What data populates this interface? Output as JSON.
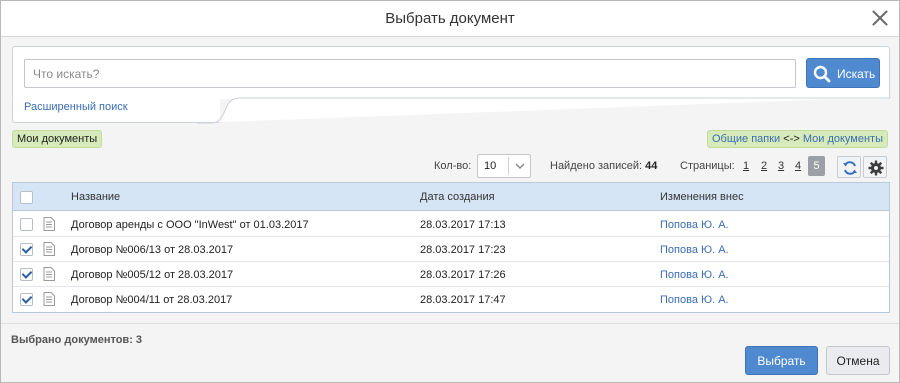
{
  "dialog": {
    "title": "Выбрать документ"
  },
  "search": {
    "placeholder": "Что искать?",
    "value": "",
    "button_label": "Искать",
    "advanced_link": "Расширенный поиск"
  },
  "filters": {
    "my_documents": "Мои документы",
    "shared_folders": "Общие папки",
    "arrow": "<->",
    "my_documents_link": "Мои документы"
  },
  "pager": {
    "count_label": "Кол-во:",
    "count_value": "10",
    "found_label": "Найдено записей:",
    "found_value": "44",
    "pages_label": "Страницы:",
    "pages": [
      "1",
      "2",
      "3",
      "4"
    ],
    "active_page": "5"
  },
  "table": {
    "columns": [
      "Название",
      "Дата создания",
      "Изменения внес"
    ],
    "rows": [
      {
        "checked": false,
        "name": "Договор аренды с ООО \"InWest\" от 01.03.2017",
        "date": "28.03.2017 17:13",
        "author": "Попова Ю. А."
      },
      {
        "checked": true,
        "name": "Договор №006/13 от 28.03.2017",
        "date": "28.03.2017 17:23",
        "author": "Попова Ю. А."
      },
      {
        "checked": true,
        "name": "Договор №005/12 от 28.03.2017",
        "date": "28.03.2017 17:26",
        "author": "Попова Ю. А."
      },
      {
        "checked": true,
        "name": "Договор №004/11 от 28.03.2017",
        "date": "28.03.2017 17:47",
        "author": "Попова Ю. А."
      }
    ]
  },
  "footer": {
    "selected_label": "Выбрано документов: 3",
    "select_button": "Выбрать",
    "cancel_button": "Отмена"
  },
  "colors": {
    "accent": "#4f8ad0",
    "header_bg": "#d6e5f6",
    "badge_bg": "#d6eaba",
    "link": "#3b6db3"
  }
}
